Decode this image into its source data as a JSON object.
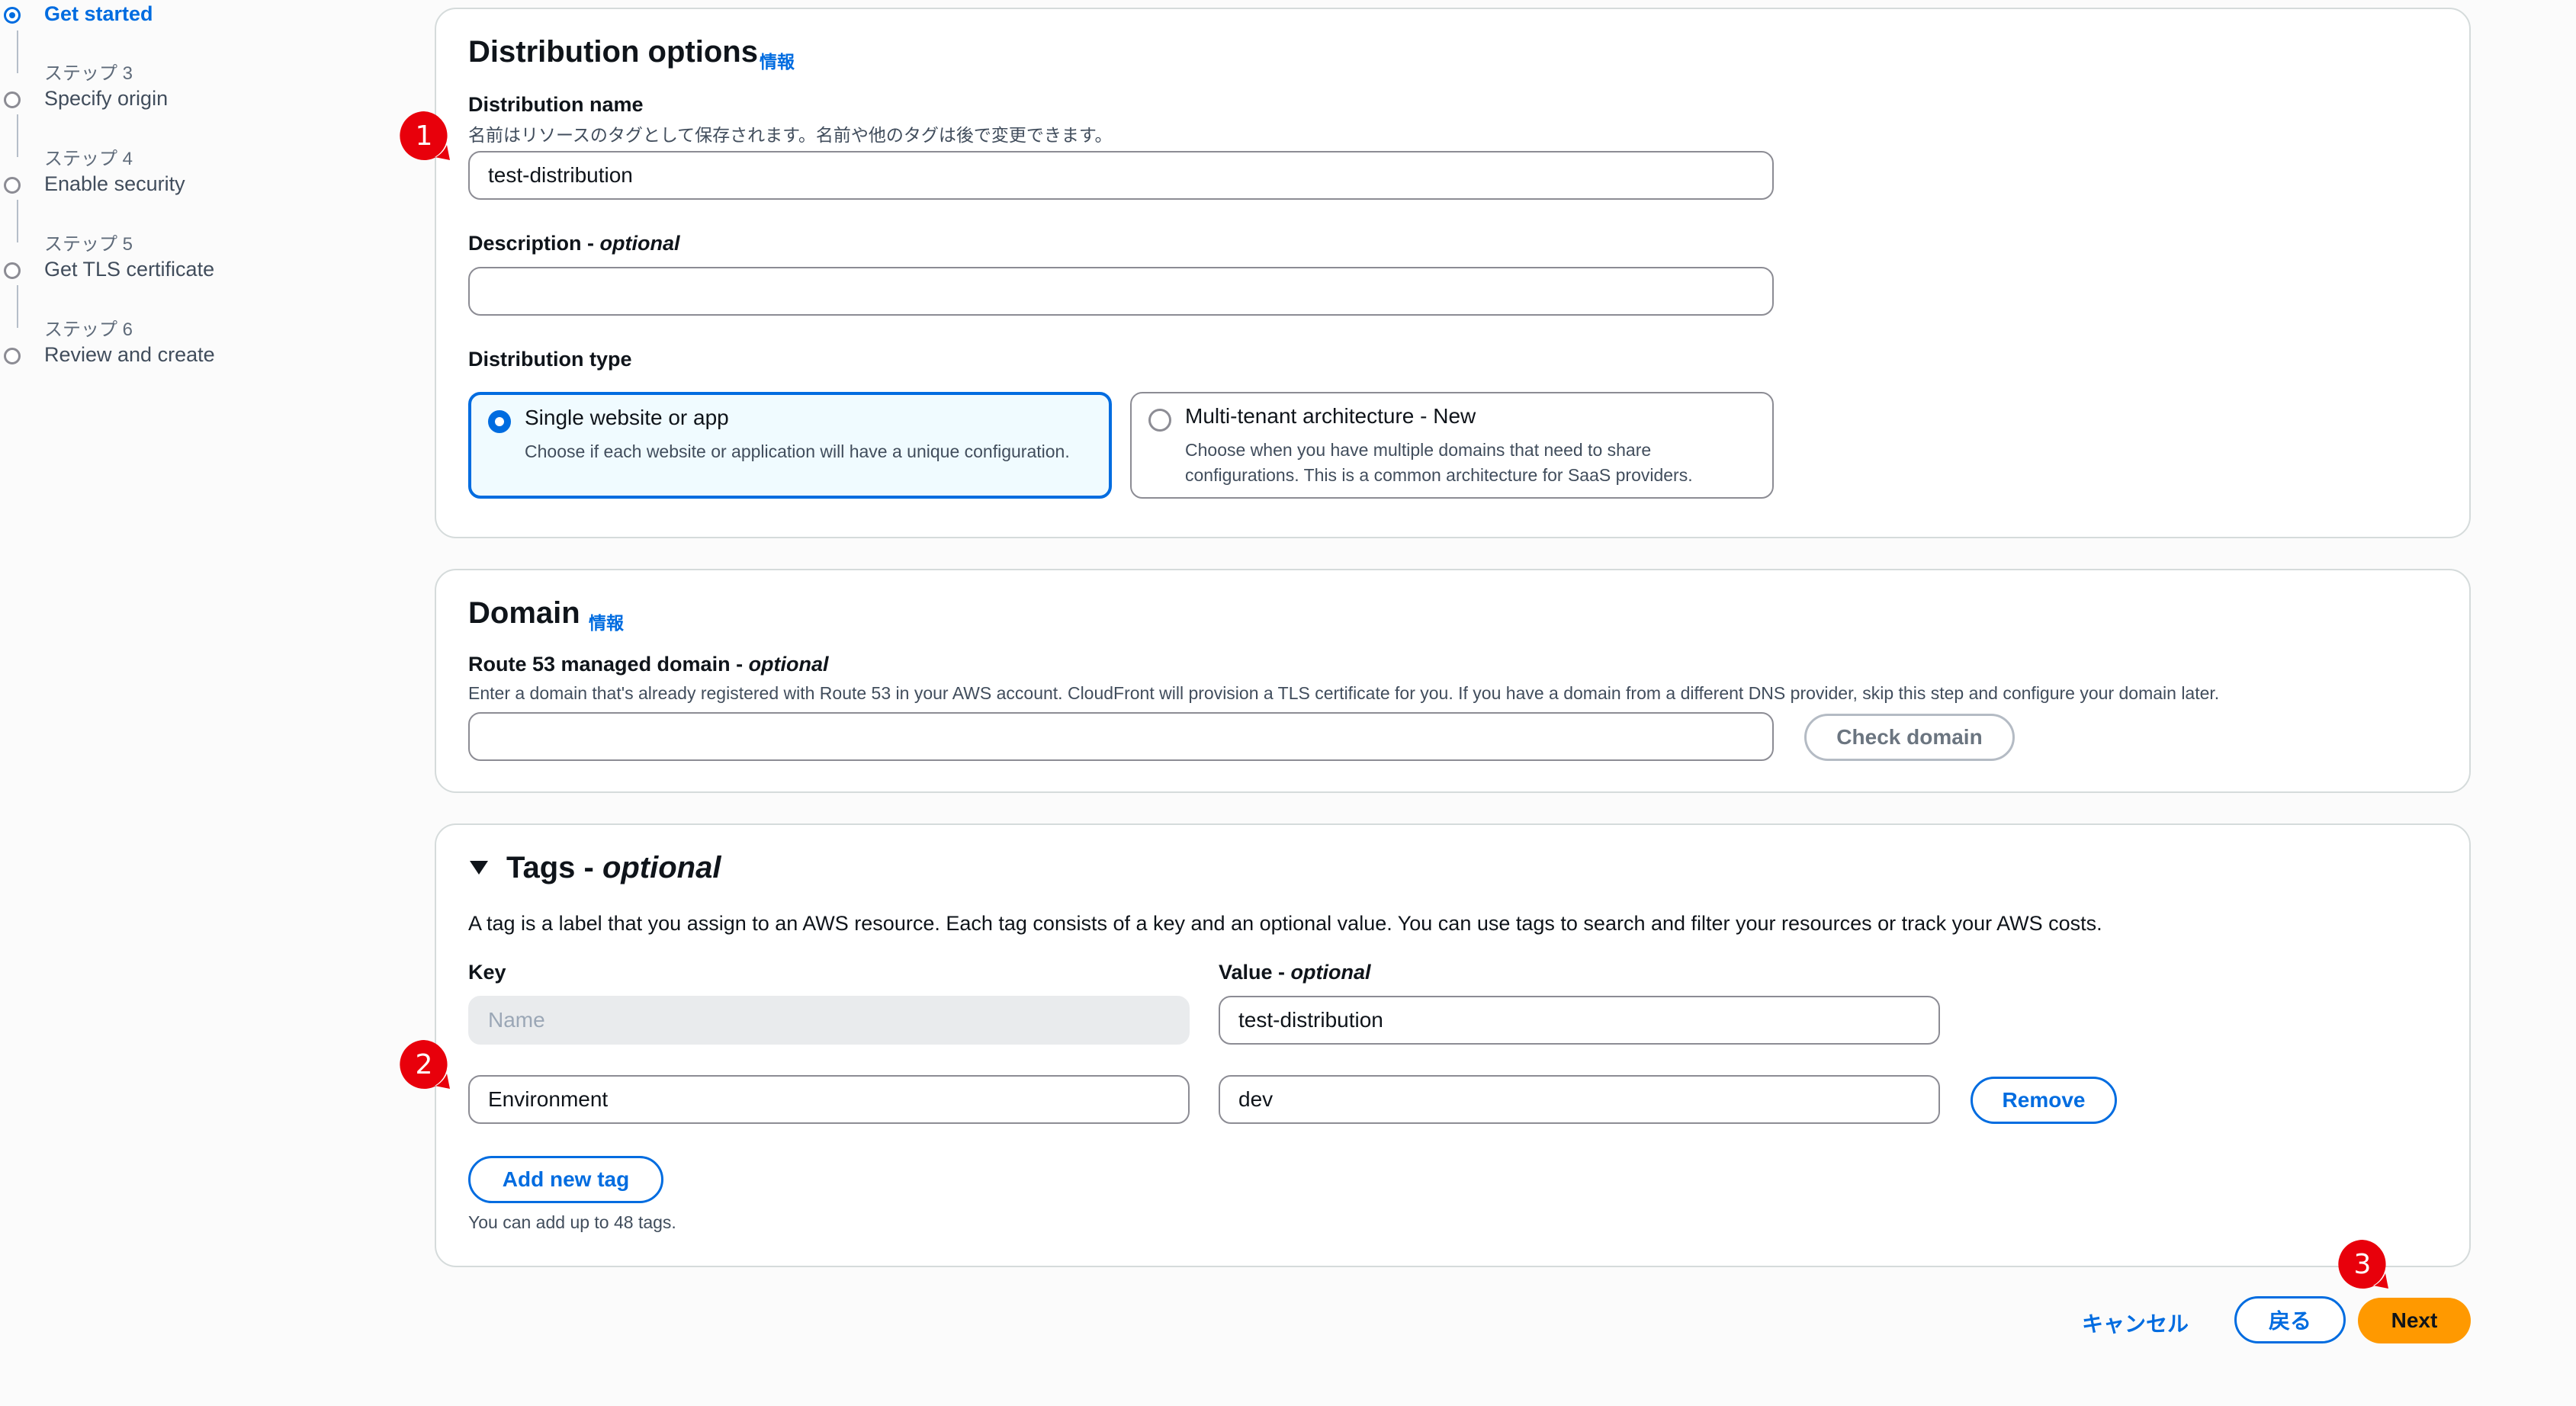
{
  "stepper": {
    "steps": [
      {
        "small": "",
        "title": "Get started",
        "active": true
      },
      {
        "small": "ステップ 3",
        "title": "Specify origin"
      },
      {
        "small": "ステップ 4",
        "title": "Enable security"
      },
      {
        "small": "ステップ 5",
        "title": "Get TLS certificate"
      },
      {
        "small": "ステップ 6",
        "title": "Review and create"
      }
    ]
  },
  "distribution_options": {
    "heading": "Distribution options",
    "info": "情報",
    "name_label": "Distribution name",
    "name_desc": "名前はリソースのタグとして保存されます。名前や他のタグは後で変更できます。",
    "name_value": "test-distribution",
    "description_label": "Description - ",
    "description_optional": "optional",
    "description_value": "",
    "type_label": "Distribution type",
    "type_options": [
      {
        "title": "Single website or app",
        "desc": "Choose if each website or application will have a unique configuration.",
        "selected": true
      },
      {
        "title": "Multi-tenant architecture - New",
        "desc": "Choose when you have multiple domains that need to share configurations. This is a common architecture for SaaS providers.",
        "selected": false
      }
    ]
  },
  "domain": {
    "heading": "Domain",
    "info": "情報",
    "label": "Route 53 managed domain - ",
    "label_optional": "optional",
    "desc": "Enter a domain that's already registered with Route 53 in your AWS account. CloudFront will provision a TLS certificate for you. If you have a domain from a different DNS provider, skip this step and configure your domain later.",
    "value": "",
    "check_button": "Check domain"
  },
  "tags": {
    "heading": "Tags - ",
    "heading_optional": "optional",
    "desc": "A tag is a label that you assign to an AWS resource. Each tag consists of a key and an optional value. You can use tags to search and filter your resources or track your AWS costs.",
    "key_label": "Key",
    "value_label": "Value - ",
    "value_optional": "optional",
    "rows": [
      {
        "key_placeholder": "Name",
        "key": "",
        "value": "test-distribution"
      },
      {
        "key": "Environment",
        "value": "dev",
        "remove": "Remove"
      }
    ],
    "add_button": "Add new tag",
    "limit_note": "You can add up to 48 tags."
  },
  "footer": {
    "cancel": "キャンセル",
    "back": "戻る",
    "next": "Next"
  },
  "annotations": [
    "1",
    "2",
    "3"
  ],
  "colors": {
    "accent": "#006ce0",
    "primary_button": "#ff9900",
    "annotation_badge": "#e8000b"
  }
}
